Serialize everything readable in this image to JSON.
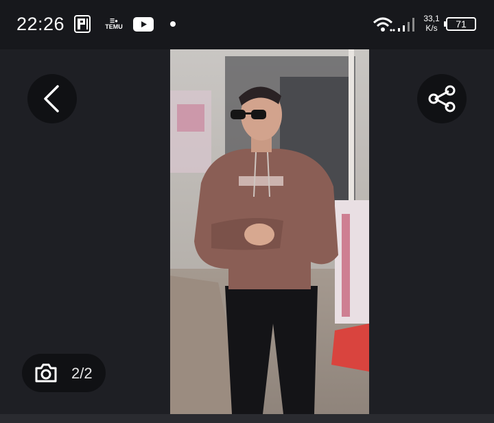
{
  "status_bar": {
    "time": "22:26",
    "notification_app_label": "TEMU",
    "network_speed_value": "33,1",
    "network_speed_unit": "K/s",
    "battery_level": "71"
  },
  "viewer": {
    "image_counter": "2/2",
    "icons": {
      "back": "chevron-left-icon",
      "share": "share-icon",
      "camera": "camera-icon"
    }
  },
  "colors": {
    "background": "#1e1f24",
    "status_bar": "#17181c",
    "button_bg": "#101114",
    "hoodie": "#8a5e55"
  }
}
